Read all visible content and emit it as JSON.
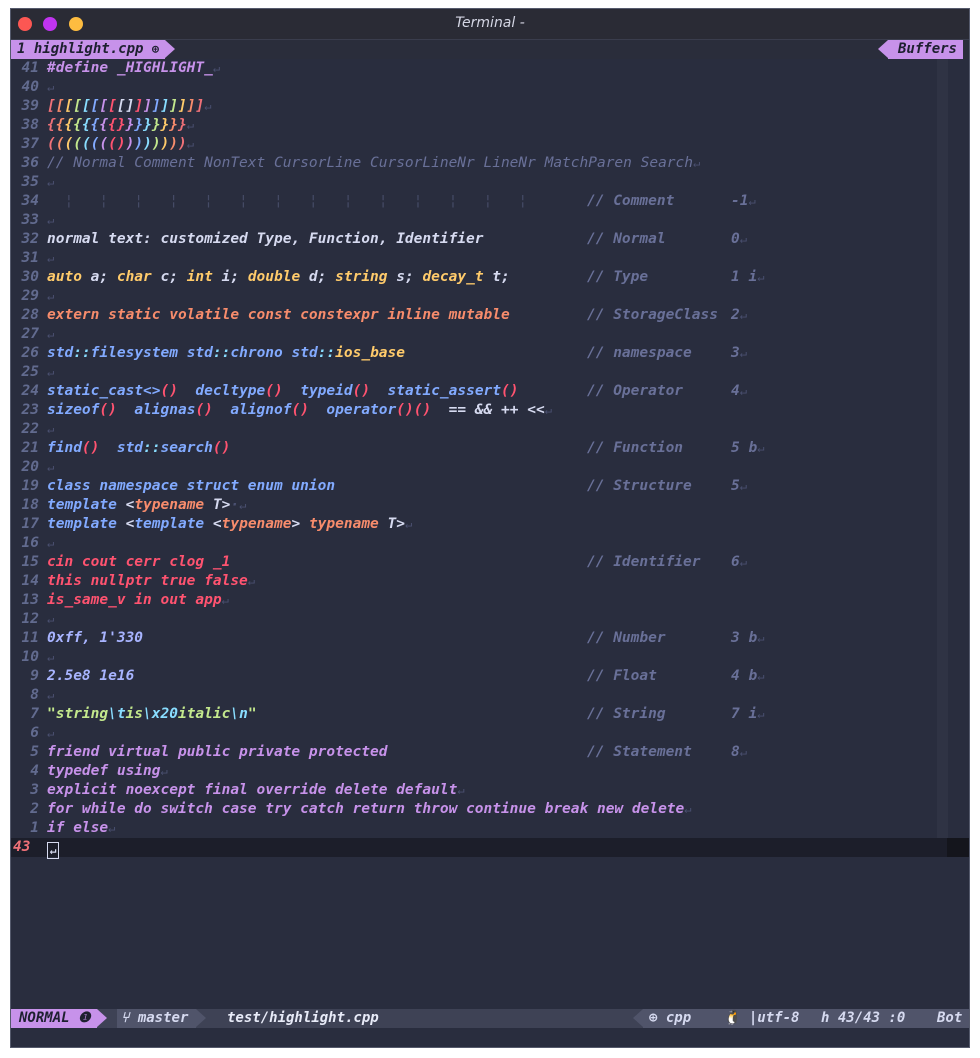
{
  "window": {
    "title": "Terminal -"
  },
  "tabline": {
    "tab_label": "1 highlight.cpp",
    "tab_icon": "⊕",
    "buffers_label": "Buffers"
  },
  "eol": "↵",
  "lines": [
    {
      "n": "41",
      "segs": [
        [
          "#define _HIGHLIGHT_",
          "#c792ea"
        ]
      ]
    },
    {
      "n": "40",
      "segs": []
    },
    {
      "n": "39",
      "segs": [
        [
          "[",
          "#f07178"
        ],
        [
          "[",
          "#f78c6c"
        ],
        [
          "[",
          "#ffcb6b"
        ],
        [
          "[",
          "#c3e88d"
        ],
        [
          "[",
          "#89ddff"
        ],
        [
          "[",
          "#82aaff"
        ],
        [
          "[",
          "#c792ea"
        ],
        [
          "[",
          "#ff5370"
        ],
        [
          "[]",
          "#d6daf0"
        ],
        [
          "]",
          "#ff5370"
        ],
        [
          "]",
          "#c792ea"
        ],
        [
          "]",
          "#82aaff"
        ],
        [
          "]",
          "#89ddff"
        ],
        [
          "]",
          "#c3e88d"
        ],
        [
          "]",
          "#ffcb6b"
        ],
        [
          "]",
          "#f78c6c"
        ],
        [
          "]",
          "#f07178"
        ]
      ]
    },
    {
      "n": "38",
      "segs": [
        [
          "{",
          "#f07178"
        ],
        [
          "{",
          "#f78c6c"
        ],
        [
          "{",
          "#ffcb6b"
        ],
        [
          "{",
          "#c3e88d"
        ],
        [
          "{",
          "#89ddff"
        ],
        [
          "{",
          "#82aaff"
        ],
        [
          "{",
          "#c792ea"
        ],
        [
          "{}",
          "#ff5370"
        ],
        [
          "}",
          "#c792ea"
        ],
        [
          "}",
          "#82aaff"
        ],
        [
          "}",
          "#89ddff"
        ],
        [
          "}",
          "#c3e88d"
        ],
        [
          "}",
          "#ffcb6b"
        ],
        [
          "}",
          "#f78c6c"
        ],
        [
          "}",
          "#f07178"
        ]
      ]
    },
    {
      "n": "37",
      "segs": [
        [
          "(",
          "#f07178"
        ],
        [
          "(",
          "#f78c6c"
        ],
        [
          "(",
          "#ffcb6b"
        ],
        [
          "(",
          "#c3e88d"
        ],
        [
          "(",
          "#89ddff"
        ],
        [
          "(",
          "#82aaff"
        ],
        [
          "(",
          "#c792ea"
        ],
        [
          "()",
          "#ff5370"
        ],
        [
          ")",
          "#c792ea"
        ],
        [
          ")",
          "#82aaff"
        ],
        [
          ")",
          "#89ddff"
        ],
        [
          ")",
          "#c3e88d"
        ],
        [
          ")",
          "#ffcb6b"
        ],
        [
          ")",
          "#f78c6c"
        ],
        [
          ")",
          "#f07178"
        ]
      ]
    },
    {
      "n": "36",
      "segs": [
        [
          "// Normal Comment NonText CursorLine CursorLineNr LineNr MatchParen Search",
          "#697098",
          1
        ]
      ]
    },
    {
      "n": "35",
      "segs": []
    },
    {
      "n": "34",
      "guides": "  ¦   ¦   ¦   ¦   ¦   ¦   ¦   ¦   ¦   ¦   ¦   ¦   ¦   ¦",
      "c": "// Comment",
      "v": "-1"
    },
    {
      "n": "33",
      "segs": []
    },
    {
      "n": "32",
      "segs": [
        [
          "normal text: customized Type, Function, Identifier",
          "#d6daf0"
        ]
      ],
      "c": "// Normal",
      "v": "0"
    },
    {
      "n": "31",
      "segs": []
    },
    {
      "n": "30",
      "segs": [
        [
          "auto",
          "#ffcb6b"
        ],
        [
          " a; ",
          "#d6daf0"
        ],
        [
          "char",
          "#ffcb6b"
        ],
        [
          " c; ",
          "#d6daf0"
        ],
        [
          "int",
          "#ffcb6b"
        ],
        [
          " i; ",
          "#d6daf0"
        ],
        [
          "double",
          "#ffcb6b"
        ],
        [
          " d; ",
          "#d6daf0"
        ],
        [
          "string",
          "#ffcb6b"
        ],
        [
          " s; ",
          "#d6daf0"
        ],
        [
          "decay_t",
          "#ffcb6b"
        ],
        [
          " t;",
          "#d6daf0"
        ]
      ],
      "c": "// Type",
      "v": "1 i"
    },
    {
      "n": "29",
      "segs": []
    },
    {
      "n": "28",
      "segs": [
        [
          "extern static volatile const constexpr inline mutable",
          "#f78c6c"
        ]
      ],
      "c": "// StorageClass",
      "v": "2"
    },
    {
      "n": "27",
      "segs": []
    },
    {
      "n": "26",
      "segs": [
        [
          "std",
          "#82aaff"
        ],
        [
          "::",
          "#89ddff"
        ],
        [
          "filesystem ",
          "#82aaff"
        ],
        [
          "std",
          "#82aaff"
        ],
        [
          "::",
          "#89ddff"
        ],
        [
          "chrono ",
          "#82aaff"
        ],
        [
          "std",
          "#82aaff"
        ],
        [
          "::",
          "#89ddff"
        ],
        [
          "ios_base",
          "#ffcb6b"
        ]
      ],
      "c": "// namespace",
      "v": "3"
    },
    {
      "n": "25",
      "segs": []
    },
    {
      "n": "24",
      "segs": [
        [
          "static_cast<>",
          "#82aaff"
        ],
        [
          "()",
          "#ff5370"
        ],
        [
          "  decltype",
          "#82aaff"
        ],
        [
          "()",
          "#ff5370"
        ],
        [
          "  typeid",
          "#82aaff"
        ],
        [
          "()",
          "#ff5370"
        ],
        [
          "  static_assert",
          "#82aaff"
        ],
        [
          "()",
          "#ff5370"
        ]
      ],
      "c": "// Operator",
      "v": "4"
    },
    {
      "n": "23",
      "segs": [
        [
          "sizeof",
          "#82aaff"
        ],
        [
          "()",
          "#ff5370"
        ],
        [
          "  alignas",
          "#82aaff"
        ],
        [
          "()",
          "#ff5370"
        ],
        [
          "  alignof",
          "#82aaff"
        ],
        [
          "()",
          "#ff5370"
        ],
        [
          "  operator",
          "#82aaff"
        ],
        [
          "()()",
          "#ff5370"
        ],
        [
          "  == && ++ <<",
          "#d6daf0"
        ]
      ]
    },
    {
      "n": "22",
      "segs": []
    },
    {
      "n": "21",
      "segs": [
        [
          "find",
          "#82aaff"
        ],
        [
          "()",
          "#ff5370"
        ],
        [
          "  std",
          "#82aaff"
        ],
        [
          "::",
          "#89ddff"
        ],
        [
          "search",
          "#82aaff"
        ],
        [
          "()",
          "#ff5370"
        ]
      ],
      "c": "// Function",
      "v": "5 b"
    },
    {
      "n": "20",
      "segs": []
    },
    {
      "n": "19",
      "segs": [
        [
          "class namespace struct enum union",
          "#82aaff"
        ]
      ],
      "c": "// Structure",
      "v": "5"
    },
    {
      "n": "18",
      "segs": [
        [
          "template",
          "#82aaff"
        ],
        [
          " <",
          "#d6daf0"
        ],
        [
          "typename",
          "#f78c6c"
        ],
        [
          " T>",
          "#d6daf0"
        ],
        [
          "·",
          "#4a5070"
        ]
      ]
    },
    {
      "n": "17",
      "segs": [
        [
          "template",
          "#82aaff"
        ],
        [
          " <",
          "#d6daf0"
        ],
        [
          "template",
          "#82aaff"
        ],
        [
          " <",
          "#d6daf0"
        ],
        [
          "typename",
          "#f78c6c"
        ],
        [
          "> ",
          "#d6daf0"
        ],
        [
          "typename",
          "#f78c6c"
        ],
        [
          " T>",
          "#d6daf0"
        ]
      ]
    },
    {
      "n": "16",
      "segs": []
    },
    {
      "n": "15",
      "segs": [
        [
          "cin cout cerr clog _1",
          "#ff5370"
        ]
      ],
      "c": "// Identifier",
      "v": "6"
    },
    {
      "n": "14",
      "segs": [
        [
          "this nullptr true false",
          "#ff5370"
        ]
      ]
    },
    {
      "n": "13",
      "segs": [
        [
          "is_same_v in out app",
          "#ff5370"
        ]
      ]
    },
    {
      "n": "12",
      "segs": []
    },
    {
      "n": "11",
      "segs": [
        [
          "0xff, 1'330",
          "#a8b4ff"
        ]
      ],
      "c": "// Number",
      "v": "3 b"
    },
    {
      "n": "10",
      "segs": []
    },
    {
      "n": "9",
      "segs": [
        [
          "2.5e8 1e16",
          "#a8b4ff"
        ]
      ],
      "c": "// Float",
      "v": "4 b"
    },
    {
      "n": "8",
      "segs": []
    },
    {
      "n": "7",
      "segs": [
        [
          "\"string",
          "#c3e88d"
        ],
        [
          "\\t",
          "#89ddff"
        ],
        [
          "is",
          "#c3e88d"
        ],
        [
          "\\x20",
          "#89ddff"
        ],
        [
          "italic",
          "#c3e88d"
        ],
        [
          "\\n",
          "#89ddff"
        ],
        [
          "\"",
          "#c3e88d"
        ]
      ],
      "c": "// String",
      "v": "7 i"
    },
    {
      "n": "6",
      "segs": []
    },
    {
      "n": "5",
      "segs": [
        [
          "friend virtual public private protected",
          "#c792ea"
        ]
      ],
      "c": "// Statement",
      "v": "8"
    },
    {
      "n": "4",
      "segs": [
        [
          "typedef using",
          "#c792ea"
        ]
      ]
    },
    {
      "n": "3",
      "segs": [
        [
          "explicit noexcept final override delete default",
          "#c792ea"
        ]
      ]
    },
    {
      "n": "2",
      "segs": [
        [
          "for while do switch case try catch return throw continue break new delete",
          "#c792ea"
        ]
      ]
    },
    {
      "n": "1",
      "segs": [
        [
          "if else",
          "#c792ea"
        ]
      ]
    }
  ],
  "current_line": {
    "n": "43"
  },
  "statusline": {
    "mode": "NORMAL",
    "mode_badge": "❶",
    "branch": "⑂ master",
    "file_path": "test/highlight.cpp",
    "filetype": "⊕ cpp",
    "encoding": "🐧 |utf-8",
    "position": "ℎ 43/43 :0",
    "percent": "Bot"
  }
}
